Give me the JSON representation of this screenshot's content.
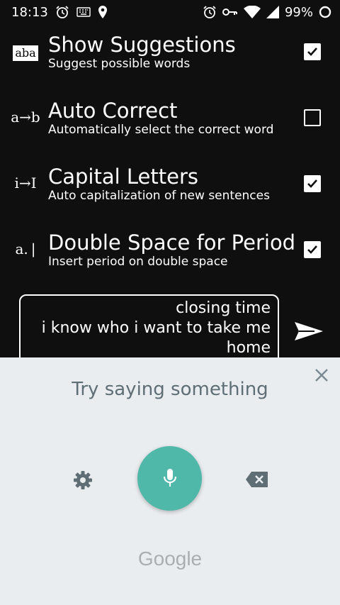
{
  "status_bar": {
    "time": "18:13",
    "battery": "99%",
    "left_icons": [
      "alarm-icon",
      "keyboard-icon",
      "location-icon"
    ],
    "right_icons": [
      "alarm-icon",
      "vpn-key-icon",
      "wifi-icon",
      "signal-icon",
      "battery-icon"
    ]
  },
  "settings": [
    {
      "icon_text": "aba",
      "title": "Show Suggestions",
      "subtitle": "Suggest possible words",
      "checked": true
    },
    {
      "icon_text": "a→b",
      "title": "Auto Correct",
      "subtitle": "Automatically select the correct word",
      "checked": false
    },
    {
      "icon_text": "i→I",
      "title": "Capital Letters",
      "subtitle": "Auto capitalization of new sentences",
      "checked": true
    },
    {
      "icon_text": "a. |",
      "title": "Double Space for Period",
      "subtitle": "Insert period on double space",
      "checked": true
    }
  ],
  "message": {
    "lines": [
      "closing time",
      "i know who i want to take me",
      "home"
    ]
  },
  "voice_panel": {
    "prompt": "Try saying something",
    "logo_text": "Google",
    "mic_color": "#4fb8a8",
    "background": "#eaedf0"
  }
}
